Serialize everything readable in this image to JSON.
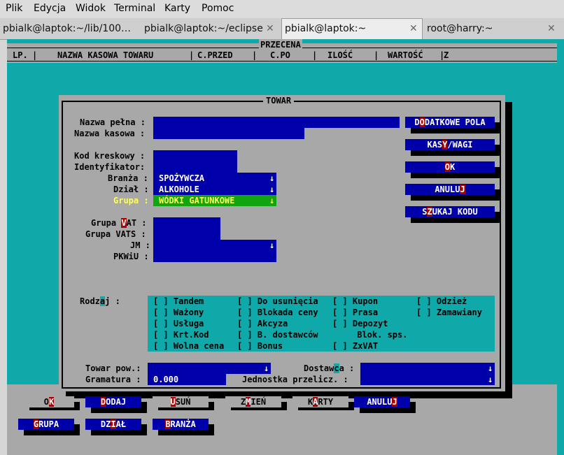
{
  "menu": [
    "Plik",
    "Edycja",
    "Widok",
    "Terminal",
    "Karty",
    "Pomoc"
  ],
  "tabs": [
    {
      "label": "pbialk@laptok:~/lib/100…"
    },
    {
      "label": "pbialk@laptok:~/eclipse"
    },
    {
      "label": "pbialk@laptok:~"
    },
    {
      "label": "root@harry:~"
    }
  ],
  "icons": {
    "close": "close-icon",
    "dropdown": "down-arrow-icon"
  },
  "screen": {
    "title": "PRZECENA",
    "columns": [
      "LP.",
      "NAZWA KASOWA TOWARU",
      "C.PRZED",
      "C.PO",
      "ILOŚĆ",
      "WARTOŚĆ",
      "Z"
    ]
  },
  "dialog": {
    "title": "TOWAR",
    "labels": {
      "nazwa_pelna": "Nazwa pełna :",
      "nazwa_kasowa": "Nazwa kasowa :",
      "kod_kreskowy": "Kod kreskowy :",
      "identyfikator": "Identyfikator:",
      "branza": "Branża :",
      "dzial": "Dział :",
      "grupa": "Grupa :",
      "grupa_vat_pre": "Grupa ",
      "grupa_vat_hot": "V",
      "grupa_vat_post": "AT :",
      "grupa_vats": "Grupa VATS :",
      "jm": "JM :",
      "pkwiu": "PKWiU :",
      "rodzaj_pre": "Rodz",
      "rodzaj_hot": "a",
      "rodzaj_post": "j :",
      "towar_pow": "Towar pow.:",
      "gramatura": "Gramatura :",
      "dostawca_pre": "Dostaw",
      "dostawca_hot": "c",
      "dostawca_post": "a :",
      "jednostka": "Jednostka przelicz. :"
    },
    "values": {
      "branza": "SPOŻYWCZA",
      "dzial": "ALKOHOLE",
      "grupa": "WÓDKI GATUNKOWE",
      "gramatura": "0.000"
    },
    "side_buttons": [
      {
        "pre": "D",
        "hot": "O",
        "post": "DATKOWE POLA"
      },
      {
        "pre": "KAS",
        "hot": "Y",
        "post": "/WAGI"
      },
      {
        "pre": "",
        "hot": "O",
        "post": "K"
      },
      {
        "pre": "ANULU",
        "hot": "J",
        "post": ""
      },
      {
        "pre": "S",
        "hot": "Z",
        "post": "UKAJ KODU"
      }
    ],
    "checkboxes": [
      {
        "box": "[ ]",
        "label": "Tandem"
      },
      {
        "box": "[ ]",
        "label": "Ważony"
      },
      {
        "box": "[ ]",
        "label": "Usługa"
      },
      {
        "box": "[ ]",
        "label": "Krt.Kod"
      },
      {
        "box": "[ ]",
        "label": "Wolna cena"
      },
      {
        "box": "[ ]",
        "label": "Do usunięcia"
      },
      {
        "box": "[ ]",
        "label": "Blokada ceny"
      },
      {
        "box": "[ ]",
        "label": "Akcyza"
      },
      {
        "box": "[ ]",
        "label": "B. dostawców"
      },
      {
        "box": "[ ]",
        "label": "Bonus"
      },
      {
        "box": "[ ]",
        "label": "Kupon"
      },
      {
        "box": "[ ]",
        "label": "Prasa"
      },
      {
        "box": "[ ]",
        "label": "Depozyt"
      },
      {
        "box": "",
        "label": "Blok. sps."
      },
      {
        "box": "[ ]",
        "label": "ZxVAT"
      },
      {
        "box": "[ ]",
        "label": "Odzież"
      },
      {
        "box": "[ ]",
        "label": "Zamawiany"
      }
    ]
  },
  "bottom_buttons": [
    {
      "pre": "O",
      "hot": "K",
      "post": ""
    },
    {
      "pre": "",
      "hot": "D",
      "post": "ODAJ"
    },
    {
      "pre": "",
      "hot": "U",
      "post": "SUŃ"
    },
    {
      "pre": "Z",
      "hot": "M",
      "post": "IEŃ"
    },
    {
      "pre": "K",
      "hot": "A",
      "post": "RTY"
    },
    {
      "pre": "ANULU",
      "hot": "J",
      "post": ""
    },
    {
      "pre": "",
      "hot": "G",
      "post": "RUPA"
    },
    {
      "pre": "DZ",
      "hot": "I",
      "post": "AŁ"
    },
    {
      "pre": "",
      "hot": "B",
      "post": "RANŻA"
    }
  ]
}
